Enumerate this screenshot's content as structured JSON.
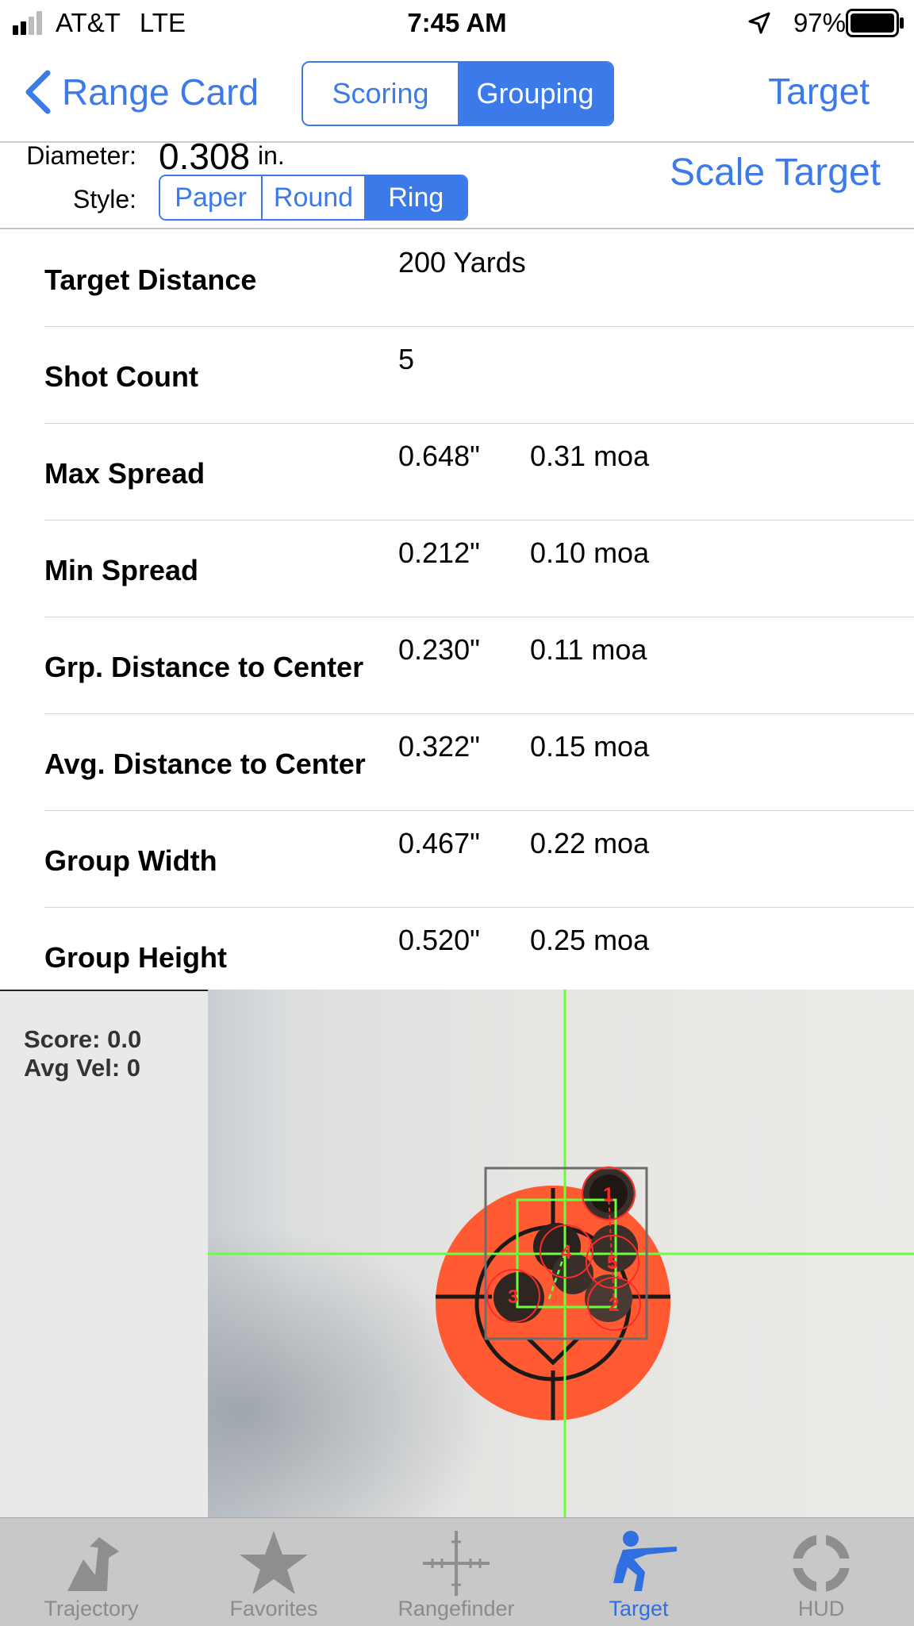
{
  "status": {
    "carrier": "AT&T",
    "network": "LTE",
    "time": "7:45 AM",
    "battery": "97%"
  },
  "nav": {
    "back_label": "Range Card",
    "segments": [
      "Scoring",
      "Grouping"
    ],
    "selected_segment": "Grouping",
    "right_label": "Target"
  },
  "settings": {
    "diameter_label": "Diameter:",
    "diameter_value": "0.308",
    "diameter_unit": "in.",
    "style_label": "Style:",
    "style_options": [
      "Paper",
      "Round",
      "Ring"
    ],
    "selected_style": "Ring",
    "scale_label": "Scale Target"
  },
  "stats": [
    {
      "label": "Target Distance",
      "value": "200 Yards",
      "moa": ""
    },
    {
      "label": "Shot Count",
      "value": "5",
      "moa": ""
    },
    {
      "label": "Max Spread",
      "value": "0.648\"",
      "moa": "0.31 moa"
    },
    {
      "label": "Min Spread",
      "value": "0.212\"",
      "moa": "0.10 moa"
    },
    {
      "label": "Grp. Distance to Center",
      "value": "0.230\"",
      "moa": "0.11 moa"
    },
    {
      "label": "Avg. Distance to Center",
      "value": "0.322\"",
      "moa": "0.15 moa"
    },
    {
      "label": "Group Width",
      "value": "0.467\"",
      "moa": "0.22 moa"
    },
    {
      "label": "Group Height",
      "value": "0.520\"",
      "moa": "0.25 moa"
    }
  ],
  "target": {
    "score": "Score: 0.0",
    "avg_vel": "Avg Vel: 0",
    "shot_numbers": [
      "1",
      "2",
      "3",
      "4",
      "5"
    ]
  },
  "tabs": [
    {
      "label": "Trajectory",
      "icon": "trajectory-icon",
      "active": false
    },
    {
      "label": "Favorites",
      "icon": "star-icon",
      "active": false
    },
    {
      "label": "Rangefinder",
      "icon": "crosshair-icon",
      "active": false
    },
    {
      "label": "Target",
      "icon": "rifleman-icon",
      "active": true
    },
    {
      "label": "HUD",
      "icon": "hud-icon",
      "active": false
    }
  ],
  "colors": {
    "accent": "#3b7ae8",
    "target_orange": "#ff5a32",
    "crosshair": "#6aff3a",
    "shot_marker": "#ff2a2a"
  }
}
